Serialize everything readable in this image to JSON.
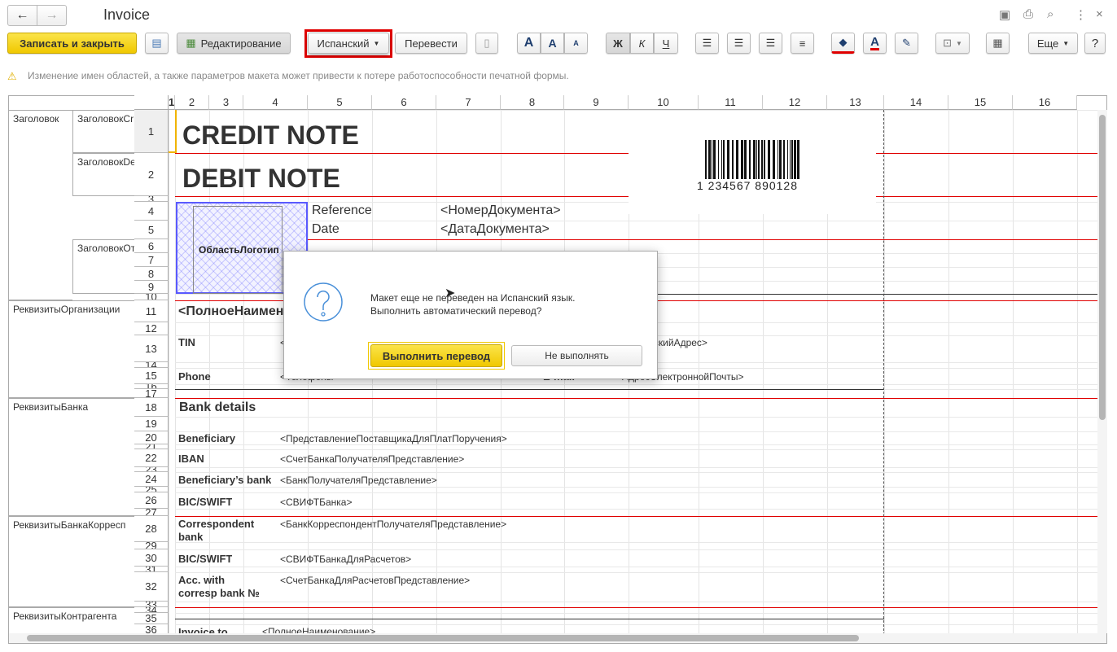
{
  "window": {
    "title": "Invoice",
    "back": "←",
    "forward": "→"
  },
  "window_icons": [
    "save-icon",
    "print-icon",
    "preview-icon",
    "more-icon",
    "close-icon"
  ],
  "toolbar": {
    "save_close": "Записать и закрыть",
    "edit_mode": "Редактирование",
    "language": "Испанский",
    "translate": "Перевести",
    "bold": "Ж",
    "italic": "К",
    "underline": "Ч",
    "font_big": "A",
    "font_inc": "A",
    "font_dec": "A",
    "more": "Еще",
    "help": "?"
  },
  "warning": "Изменение имен областей, а также параметров макета может привести к потере работоспособности печатной формы.",
  "grid": {
    "columns": [
      "1",
      "2",
      "3",
      "4",
      "5",
      "6",
      "7",
      "8",
      "9",
      "10",
      "11",
      "12",
      "13",
      "14",
      "15",
      "16"
    ],
    "rows": [
      "1",
      "2",
      "3",
      "4",
      "5",
      "6",
      "7",
      "8",
      "9",
      "10",
      "11",
      "12",
      "13",
      "14",
      "15",
      "16",
      "17",
      "18",
      "19",
      "20",
      "21",
      "22",
      "23",
      "24",
      "25",
      "26",
      "27",
      "28",
      "29",
      "30",
      "31",
      "32",
      "33",
      "34",
      "35",
      "36"
    ],
    "groups": [
      {
        "label": "Заголовок"
      },
      {
        "label": "ЗаголовокCr"
      },
      {
        "label": "ЗаголовокDe"
      },
      {
        "label": "ЗаголовокОт"
      },
      {
        "label": "РеквизитыОрганизации"
      },
      {
        "label": "РеквизитыБанка"
      },
      {
        "label": "РеквизитыБанкаКорресп"
      },
      {
        "label": "РеквизитыКонтрагента"
      }
    ],
    "cells": {
      "credit_note": "CREDIT NOTE",
      "debit_note": "DEBIT NOTE",
      "reference": "Reference",
      "reference_val": "<НомерДокумента>",
      "date": "Date",
      "date_val": "<ДатаДокумента>",
      "logo_area": "ОбластьЛоготип",
      "full_name": "<ПолноеНаименование>",
      "tin": "TIN",
      "tin_val": "<",
      "address_val": "ческийАдрес>",
      "phone": "Phone",
      "phone_val": "<Телефоны>",
      "empty_val": "<>",
      "email": "E-mail",
      "email_val": "<АдресЭлектроннойПочты>",
      "bank_details": "Bank details",
      "beneficiary": "Beneficiary",
      "beneficiary_val": "<ПредставлениеПоставщикаДляПлатПоручения>",
      "iban": "IBAN",
      "iban_val": "<СчетБанкаПолучателяПредставление>",
      "beneficiary_bank": "Beneficiary’s bank",
      "beneficiary_bank_val": "<БанкПолучателяПредставление>",
      "bic": "BIC/SWIFT",
      "bic_val": "<СВИФТБанка>",
      "corr_bank_1": "Correspondent",
      "corr_bank_2": "bank",
      "corr_bank_val": "<БанкКорреспондентПолучателяПредставление>",
      "bic2": "BIC/SWIFT",
      "bic2_val": "<СВИФТБанкаДляРасчетов>",
      "acc_1": "Acc. with",
      "acc_2": "corresp bank №",
      "acc_val": "<СчетБанкаДляРасчетовПредставление>",
      "invoice_to": "Invoice to",
      "invoice_to_val": "<ПолноеНаименование>"
    },
    "barcode_text": "1 234567 890128"
  },
  "dialog": {
    "icon": "question-icon",
    "line1": "Макет еще не переведен на Испанский язык.",
    "line2": "Выполнить автоматический перевод?",
    "ok": "Выполнить перевод",
    "cancel": "Не выполнять"
  },
  "colors": {
    "primary_button": "#f5d00f",
    "region_line": "#e00000",
    "highlight": "#e00000",
    "selection": "#5a5aff"
  }
}
